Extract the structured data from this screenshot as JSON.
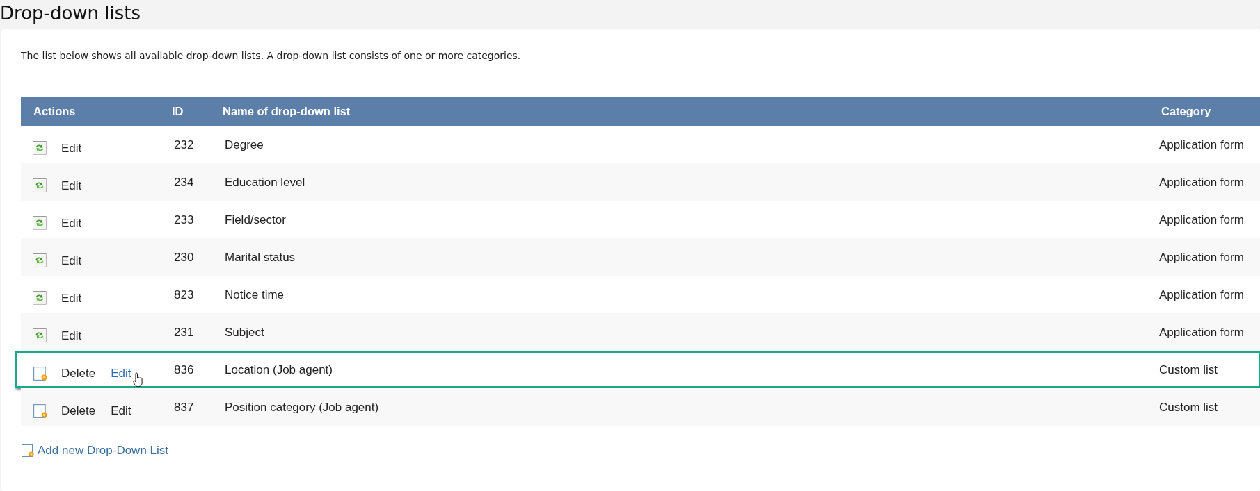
{
  "page": {
    "title": "Drop-down lists",
    "description": "The list below shows all available drop-down lists. A drop-down list consists of one or more categories."
  },
  "table": {
    "columns": [
      "Actions",
      "ID",
      "Name of drop-down list",
      "Category"
    ],
    "rows": [
      {
        "kind": "system",
        "highlighted": false,
        "actions": [
          {
            "label": "Edit",
            "hovered": false
          }
        ],
        "id": "232",
        "name": "Degree",
        "category": "Application form"
      },
      {
        "kind": "system",
        "highlighted": false,
        "actions": [
          {
            "label": "Edit",
            "hovered": false
          }
        ],
        "id": "234",
        "name": "Education level",
        "category": "Application form"
      },
      {
        "kind": "system",
        "highlighted": false,
        "actions": [
          {
            "label": "Edit",
            "hovered": false
          }
        ],
        "id": "233",
        "name": "Field/sector",
        "category": "Application form"
      },
      {
        "kind": "system",
        "highlighted": false,
        "actions": [
          {
            "label": "Edit",
            "hovered": false
          }
        ],
        "id": "230",
        "name": "Marital status",
        "category": "Application form"
      },
      {
        "kind": "system",
        "highlighted": false,
        "actions": [
          {
            "label": "Edit",
            "hovered": false
          }
        ],
        "id": "823",
        "name": "Notice time",
        "category": "Application form"
      },
      {
        "kind": "system",
        "highlighted": false,
        "actions": [
          {
            "label": "Edit",
            "hovered": false
          }
        ],
        "id": "231",
        "name": "Subject",
        "category": "Application form"
      },
      {
        "kind": "custom",
        "highlighted": true,
        "actions": [
          {
            "label": "Delete",
            "hovered": false
          },
          {
            "label": "Edit",
            "hovered": true
          }
        ],
        "id": "836",
        "name": "Location (Job agent)",
        "category": "Custom list"
      },
      {
        "kind": "custom",
        "highlighted": false,
        "actions": [
          {
            "label": "Delete",
            "hovered": false
          },
          {
            "label": "Edit",
            "hovered": false
          }
        ],
        "id": "837",
        "name": "Position category (Job agent)",
        "category": "Custom list"
      }
    ]
  },
  "add_link": "Add new Drop-Down List"
}
